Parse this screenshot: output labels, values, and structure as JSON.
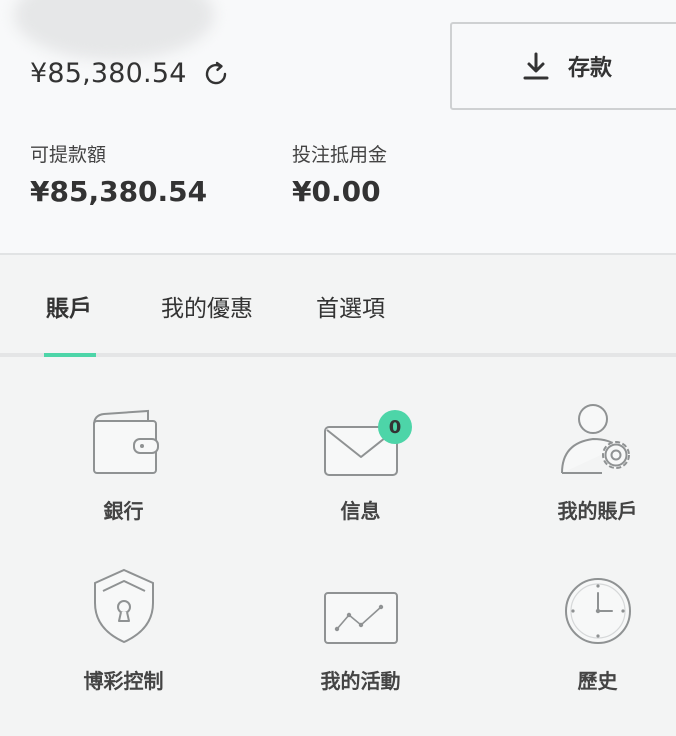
{
  "summary": {
    "balance": "¥85,380.54",
    "deposit_label": "存款",
    "withdrawable_label": "可提款額",
    "withdrawable_value": "¥85,380.54",
    "bet_credit_label": "投注抵用金",
    "bet_credit_value": "¥0.00"
  },
  "tabs": {
    "items": [
      {
        "label": "賬戶",
        "active": true
      },
      {
        "label": "我的優惠",
        "active": false
      },
      {
        "label": "首選項",
        "active": false
      }
    ]
  },
  "grid": {
    "items": [
      {
        "label": "銀行",
        "icon": "wallet-icon"
      },
      {
        "label": "信息",
        "icon": "envelope-icon",
        "badge": "0"
      },
      {
        "label": "我的賬戶",
        "icon": "user-settings-icon"
      },
      {
        "label": "博彩控制",
        "icon": "shield-lock-icon"
      },
      {
        "label": "我的活動",
        "icon": "activity-chart-icon"
      },
      {
        "label": "歷史",
        "icon": "clock-icon"
      }
    ]
  },
  "colors": {
    "accent": "#4dd5a8",
    "text": "#333333",
    "icon_stroke": "#8f9293"
  }
}
